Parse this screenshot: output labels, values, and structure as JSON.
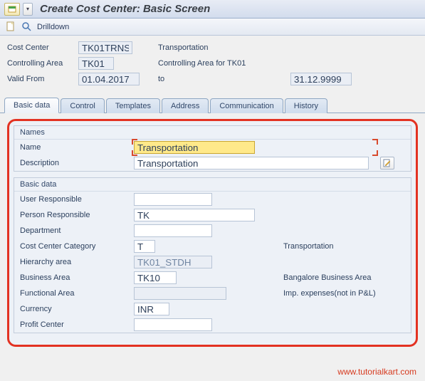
{
  "title": "Create Cost Center: Basic Screen",
  "toolbar": {
    "drilldown": "Drilldown"
  },
  "header": {
    "cost_center_label": "Cost Center",
    "cost_center_value": "TK01TRNS",
    "cost_center_text": "Transportation",
    "controlling_area_label": "Controlling Area",
    "controlling_area_value": "TK01",
    "controlling_area_text": "Controlling Area for TK01",
    "valid_from_label": "Valid From",
    "valid_from_value": "01.04.2017",
    "to_label": "to",
    "valid_to_value": "31.12.9999"
  },
  "tabs": {
    "basic_data": "Basic data",
    "control": "Control",
    "templates": "Templates",
    "address": "Address",
    "communication": "Communication",
    "history": "History"
  },
  "names": {
    "group_title": "Names",
    "name_label": "Name",
    "name_value": "Transportation",
    "description_label": "Description",
    "description_value": "Transportation"
  },
  "basic": {
    "group_title": "Basic data",
    "user_responsible_label": "User Responsible",
    "user_responsible_value": "",
    "person_responsible_label": "Person Responsible",
    "person_responsible_value": "TK",
    "department_label": "Department",
    "department_value": "",
    "cc_category_label": "Cost Center Category",
    "cc_category_value": "T",
    "cc_category_text": "Transportation",
    "hierarchy_label": "Hierarchy area",
    "hierarchy_value": "TK01_STDH",
    "business_area_label": "Business Area",
    "business_area_value": "TK10",
    "business_area_text": "Bangalore Business Area",
    "functional_area_label": "Functional Area",
    "functional_area_value": "",
    "functional_area_text": "Imp. expenses(not in P&L)",
    "currency_label": "Currency",
    "currency_value": "INR",
    "profit_center_label": "Profit Center",
    "profit_center_value": ""
  },
  "watermark": "www.tutorialkart.com"
}
